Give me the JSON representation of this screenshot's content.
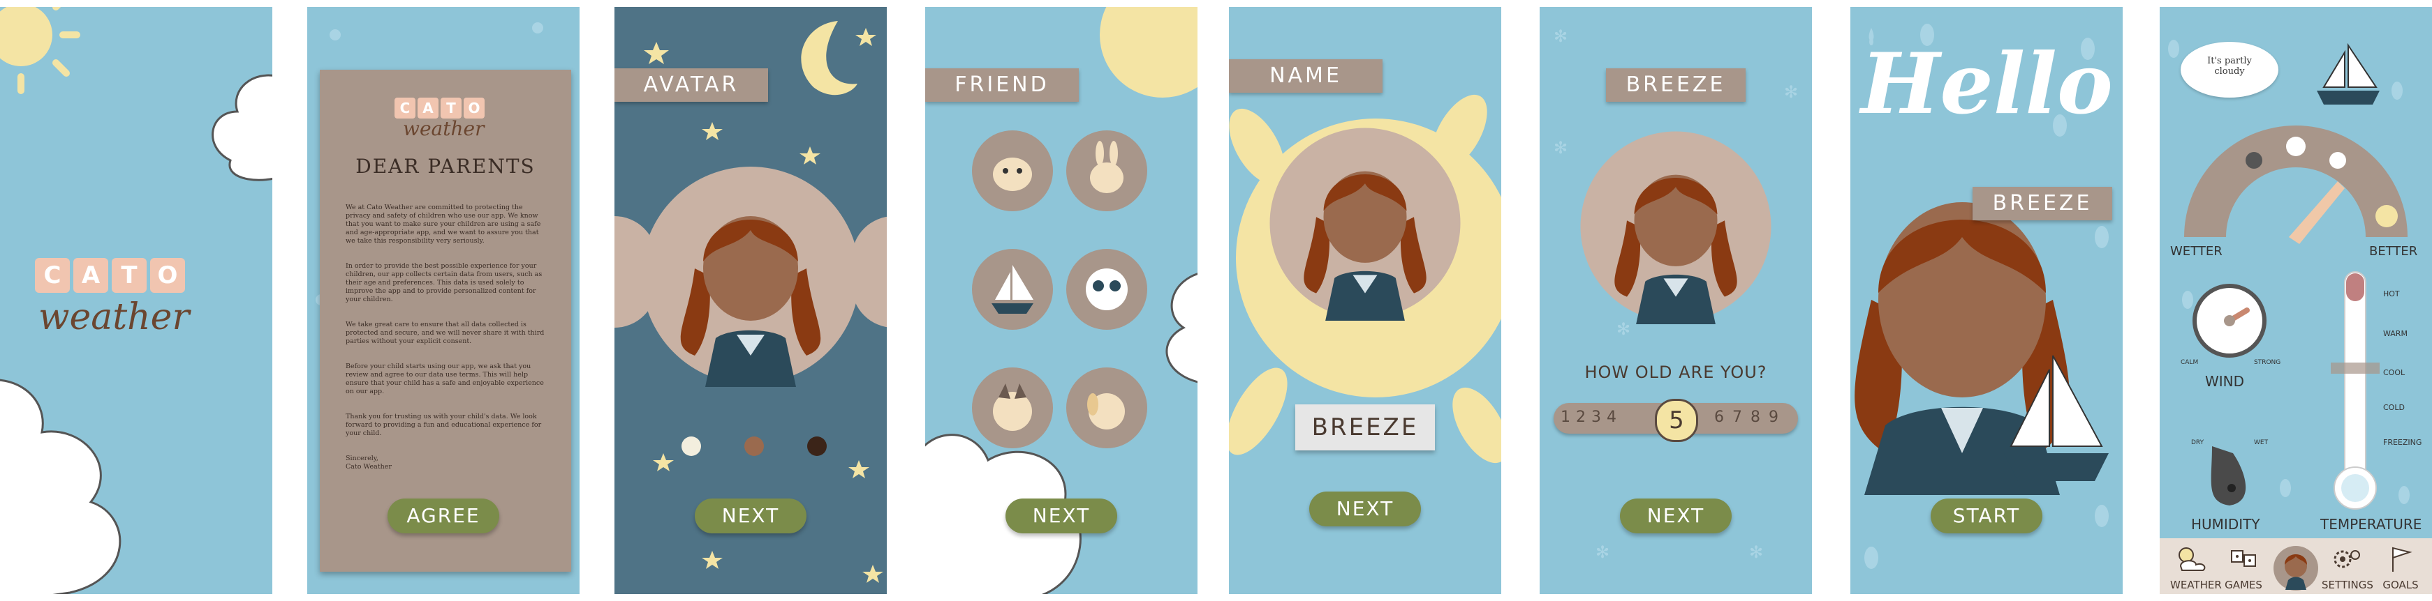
{
  "screens": {
    "splash": {
      "logo_blocks": [
        "C",
        "A",
        "T",
        "O"
      ],
      "logo_word": "weather"
    },
    "parents": {
      "logo_blocks": [
        "C",
        "A",
        "T",
        "O"
      ],
      "logo_word": "weather",
      "title": "DEAR PARENTS",
      "paragraphs": [
        "We at Cato Weather are committed to protecting the privacy and safety of children who use our app. We know that you want to make sure your children are using a safe and age-appropriate app, and we want to assure you that we take this responsibility very seriously.",
        "In order to provide the best possible experience for your children, our app collects certain data from users, such as their age and preferences. This data is used solely to improve the app and to provide personalized content for your children.",
        "We take great care to ensure that all data collected is protected and secure, and we will never share it with third parties without your explicit consent.",
        "Before your child starts using our app, we ask that you review and agree to our data use terms. This will help ensure that your child has a safe and enjoyable experience on our app.",
        "Thank you for trusting us with your child's data. We look forward to providing a fun and educational experience for your child.",
        "Sincerely,\nCato Weather"
      ],
      "button": "AGREE"
    },
    "avatar": {
      "title": "AVATAR",
      "button": "NEXT"
    },
    "friend": {
      "title": "FRIEND",
      "button": "NEXT"
    },
    "name": {
      "title": "NAME",
      "name_value": "BREEZE",
      "button": "NEXT"
    },
    "age": {
      "title": "BREEZE",
      "question": "HOW OLD ARE YOU?",
      "ages": [
        "1",
        "2",
        "3",
        "4",
        "5",
        "6",
        "7",
        "8",
        "9"
      ],
      "selected_age": "5",
      "button": "NEXT"
    },
    "hello": {
      "greeting": "Hello",
      "name": "BREEZE",
      "button": "START"
    },
    "dashboard": {
      "speech": "It's partly cloudy",
      "gauge_left": "WETTER",
      "gauge_right": "BETTER",
      "wind_label": "WIND",
      "wind_calm": "CALM",
      "wind_strong": "STRONG",
      "humidity_label": "HUMIDITY",
      "humidity_dry": "DRY",
      "humidity_wet": "WET",
      "temperature_label": "TEMPERATURE",
      "temp_scale": [
        "HOT",
        "WARM",
        "COOL",
        "COLD",
        "FREEZING"
      ],
      "nav": [
        "WEATHER",
        "GAMES",
        "",
        "SETTINGS",
        "GOALS"
      ]
    }
  },
  "colors": {
    "sky": "#8ec5d8",
    "night": "#4f7386",
    "paper": "#a8968a",
    "button": "#7b8c4a",
    "sun": "#f4e4a4"
  }
}
